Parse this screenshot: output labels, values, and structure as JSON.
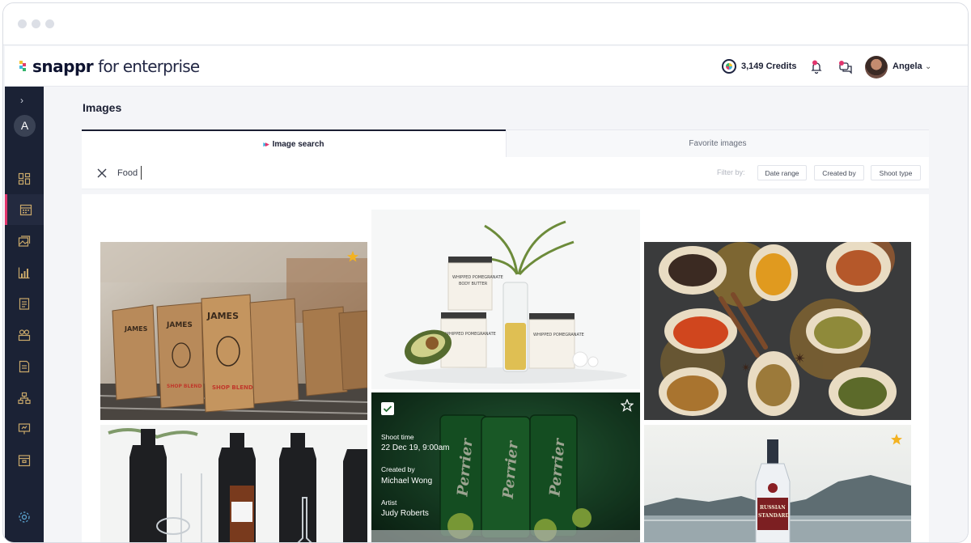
{
  "brand": {
    "name": "snappr",
    "suffix": "for enterprise"
  },
  "header": {
    "credits": "3,149 Credits",
    "user_name": "Angela"
  },
  "page": {
    "title": "Images"
  },
  "tabs": [
    {
      "label": "Image search",
      "active": true
    },
    {
      "label": "Favorite images",
      "active": false
    }
  ],
  "search": {
    "value": "Food",
    "placeholder": ""
  },
  "filters": {
    "label": "Filter by:",
    "chips": [
      "Date range",
      "Created by",
      "Shoot type"
    ]
  },
  "sidebar": {
    "avatar_letter": "A"
  },
  "gallery": {
    "images": [
      {
        "subject": "coffee bags on shelf",
        "favorite": true
      },
      {
        "subject": "body butter jars with avocado and vase",
        "favorite": false
      },
      {
        "subject": "spices in wooden spoons",
        "favorite": false
      },
      {
        "subject": "dark glass bottles and lab glassware",
        "favorite": false
      },
      {
        "subject": "perrier cans with limes",
        "favorite": false,
        "selected": true
      },
      {
        "subject": "russian standard vodka by lake",
        "favorite": true
      }
    ],
    "hover_details": {
      "shoot_time_label": "Shoot time",
      "shoot_time": "22 Dec 19, 9:00am",
      "created_by_label": "Created by",
      "created_by": "Michael Wong",
      "artist_label": "Artist",
      "artist": "Judy Roberts"
    }
  },
  "colors": {
    "accent": "#e1356d",
    "sidebar_bg": "#1b2235",
    "star": "#f3b221"
  }
}
